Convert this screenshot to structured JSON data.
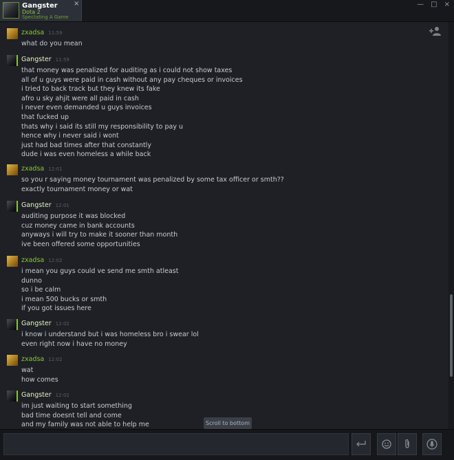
{
  "tab": {
    "name": "Gangster",
    "game": "Dota 2",
    "status": "Spectating A Game",
    "close": "×"
  },
  "window_controls": {
    "minimize": "—",
    "maximize": "□",
    "close": "×"
  },
  "chat": {
    "groups": [
      {
        "user": "zxadsa",
        "time": "11:59",
        "avatar": "gold-avatar",
        "messages": [
          "what do you mean"
        ]
      },
      {
        "user": "Gangster",
        "time": "11:59",
        "avatar": "dark-avatar",
        "messages": [
          "that money was penalized for auditing as i could not show taxes",
          "all of u guys were paid in cash without any pay cheques or invoices",
          "i tried to back track but they knew its fake",
          "afro u sky ahjit were all paid in cash",
          "i never even demanded u guys invoices",
          "that fucked up",
          "thats why i said its still my responsibility to pay u",
          "hence why i never said i wont",
          "just had bad times after that constantly",
          "dude i was even homeless a while back"
        ]
      },
      {
        "user": "zxadsa",
        "time": "12:01",
        "avatar": "gold-avatar",
        "messages": [
          "so you r saying money tournament was penalized by some tax officer or smth??",
          "exactly tournament money or wat"
        ]
      },
      {
        "user": "Gangster",
        "time": "12:01",
        "avatar": "dark-avatar",
        "messages": [
          "auditing purpose it was blocked",
          "cuz money came in bank accounts",
          "anyways i will try to make it sooner than month",
          "ive been offered some opportunities"
        ]
      },
      {
        "user": "zxadsa",
        "time": "12:02",
        "avatar": "gold-avatar",
        "messages": [
          "i mean you guys could ve send me smth atleast",
          "dunno",
          "so i be calm",
          "i mean 500 bucks or smth",
          "if you got issues here"
        ]
      },
      {
        "user": "Gangster",
        "time": "12:02",
        "avatar": "dark-avatar",
        "messages": [
          "i know i understand but i was homeless bro i swear lol",
          "even right now i have no money"
        ]
      },
      {
        "user": "zxadsa",
        "time": "12:02",
        "avatar": "gold-avatar",
        "messages": [
          "wat",
          "how comes"
        ]
      },
      {
        "user": "Gangster",
        "time": "12:02",
        "avatar": "dark-avatar",
        "messages": [
          "im just waiting to start something",
          "bad time doesnt tell and come",
          "and my family was not able to help me"
        ]
      }
    ]
  },
  "scroll_to_bottom": "Scroll to bottom",
  "input": {
    "value": "",
    "placeholder": ""
  },
  "colors": {
    "background": "#1e2025",
    "ingame_green": "#8bc53f",
    "message_text": "#c8ccd2",
    "timestamp": "#5a5f68"
  },
  "icons": [
    "add-friends-icon",
    "send-icon",
    "emoticon-icon",
    "attach-icon",
    "voice-icon"
  ]
}
